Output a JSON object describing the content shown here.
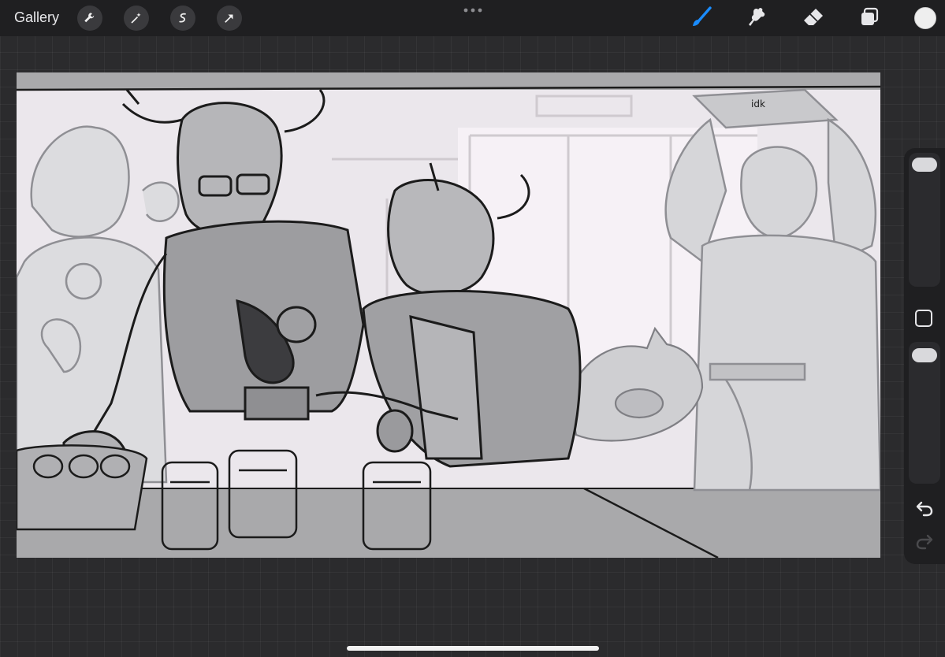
{
  "topbar": {
    "gallery_label": "Gallery",
    "left_tools": [
      "wrench-icon",
      "magic-wand-icon",
      "selection-icon",
      "transform-arrow-icon"
    ],
    "right_tools": [
      "brush-icon",
      "smudge-icon",
      "eraser-icon",
      "layers-icon"
    ],
    "active_tool": "brush-icon",
    "accent_color": "#1a8cff",
    "current_color": "#eeeeee"
  },
  "canvas": {
    "background": "#a9a9ab",
    "sketch_labels": {
      "note": "idk"
    }
  },
  "sidebar": {
    "brush_size_fraction": 0.9,
    "opacity_fraction": 0.9,
    "undo_icon": "undo-icon",
    "redo_icon": "redo-icon"
  }
}
